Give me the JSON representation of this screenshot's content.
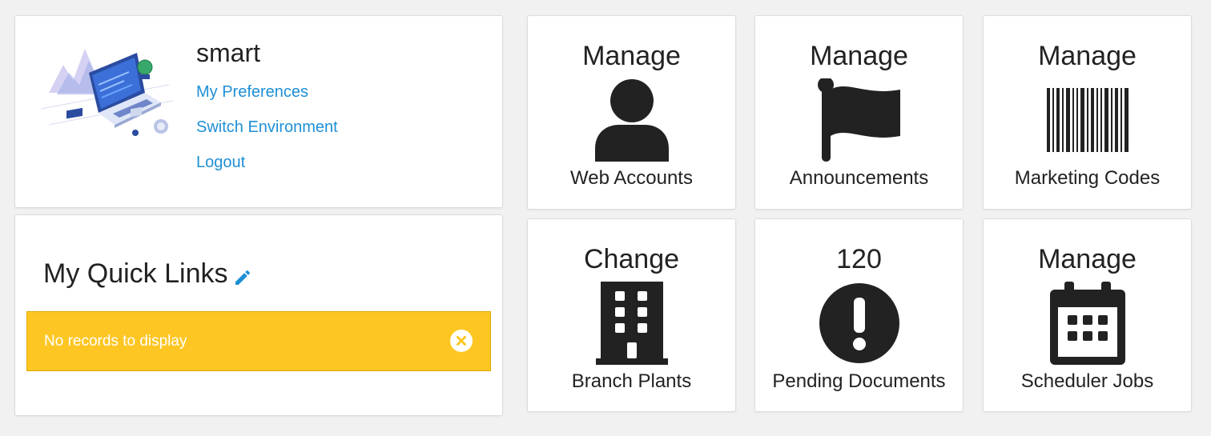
{
  "profile": {
    "username": "smart",
    "links": {
      "preferences": "My Preferences",
      "switch_environment": "Switch Environment",
      "logout": "Logout"
    },
    "illustration_icon": "laptop-dashboard-illustration"
  },
  "quick_links": {
    "title": "My Quick Links",
    "edit_icon": "pencil-icon",
    "empty_message": "No records to display",
    "close_icon": "close-circle-icon",
    "banner_color": "#fdc623"
  },
  "tiles": [
    {
      "top": "Manage",
      "bottom": "Web Accounts",
      "icon": "user-icon"
    },
    {
      "top": "Manage",
      "bottom": "Announcements",
      "icon": "flag-icon"
    },
    {
      "top": "Manage",
      "bottom": "Marketing Codes",
      "icon": "barcode-icon"
    },
    {
      "top": "Change",
      "bottom": "Branch Plants",
      "icon": "building-icon"
    },
    {
      "top": "120",
      "bottom": "Pending Documents",
      "icon": "exclamation-circle-icon"
    },
    {
      "top": "Manage",
      "bottom": "Scheduler Jobs",
      "icon": "calendar-icon"
    }
  ],
  "colors": {
    "link": "#1e8fd6",
    "icon": "#222222",
    "background": "#f1f1f1"
  }
}
